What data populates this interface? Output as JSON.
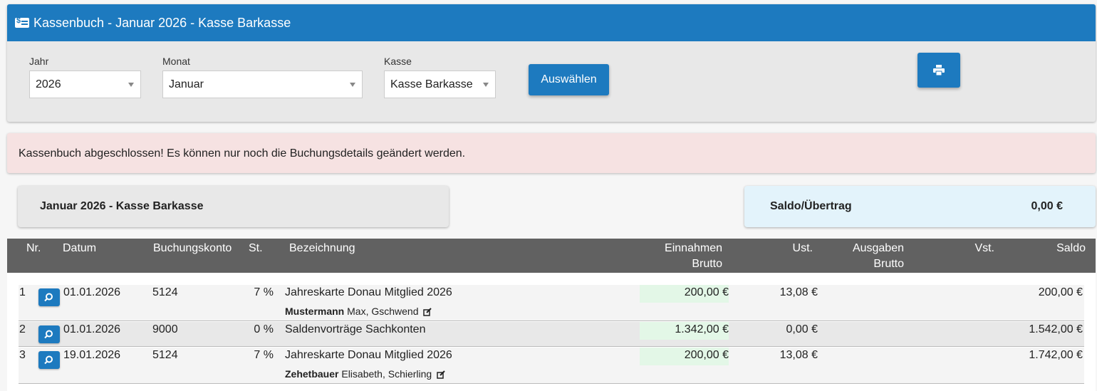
{
  "header": {
    "title": "Kassenbuch - Januar 2026 - Kasse Barkasse"
  },
  "filters": {
    "year": {
      "label": "Jahr",
      "value": "2026"
    },
    "month": {
      "label": "Monat",
      "value": "Januar"
    },
    "register": {
      "label": "Kasse",
      "value": "Kasse Barkasse"
    },
    "select_button": "Auswählen"
  },
  "alert": {
    "text": "Kassenbuch abgeschlossen! Es können nur noch die Buchungsdetails geändert werden."
  },
  "summary": {
    "period": "Januar 2026 - Kasse Barkasse",
    "balance_label": "Saldo/Übertrag",
    "balance_value": "0,00 €"
  },
  "table": {
    "headers": {
      "nr": "Nr.",
      "datum": "Datum",
      "konto": "Buchungskonto",
      "st": "St.",
      "bez": "Bezeichnung",
      "einnahmen": "Einnahmen",
      "einnahmen2": "Brutto",
      "ust": "Ust.",
      "ausgaben": "Ausgaben",
      "ausgaben2": "Brutto",
      "vst": "Vst.",
      "saldo": "Saldo"
    },
    "rows": [
      {
        "nr": "1",
        "datum": "01.01.2026",
        "konto": "5124",
        "st": "7 %",
        "bez": "Jahreskarte Donau Mitglied 2026",
        "person_last": "Mustermann",
        "person_rest": "Max, Gschwend",
        "einnahmen": "200,00 €",
        "ust": "13,08 €",
        "ausgaben": "",
        "vst": "",
        "saldo": "200,00 €"
      },
      {
        "nr": "2",
        "datum": "01.01.2026",
        "konto": "9000",
        "st": "0 %",
        "bez": "Saldenvorträge Sachkonten",
        "person_last": "",
        "person_rest": "",
        "einnahmen": "1.342,00 €",
        "ust": "0,00 €",
        "ausgaben": "",
        "vst": "",
        "saldo": "1.542,00 €"
      },
      {
        "nr": "3",
        "datum": "19.01.2026",
        "konto": "5124",
        "st": "7 %",
        "bez": "Jahreskarte Donau Mitglied 2026",
        "person_last": "Zehetbauer",
        "person_rest": "Elisabeth, Schierling",
        "einnahmen": "200,00 €",
        "ust": "13,08 €",
        "ausgaben": "",
        "vst": "",
        "saldo": "1.742,00 €"
      }
    ]
  },
  "colors": {
    "primary": "#1d7abf",
    "header_dark": "#616161",
    "alert_bg": "#f6e2e2",
    "income_bg": "#e3f7e7",
    "balance_bg": "#e3f3fb"
  },
  "icons": {
    "header": "cash-register-icon",
    "print": "print-icon",
    "detail": "magnifier-icon",
    "edit": "edit-icon"
  }
}
